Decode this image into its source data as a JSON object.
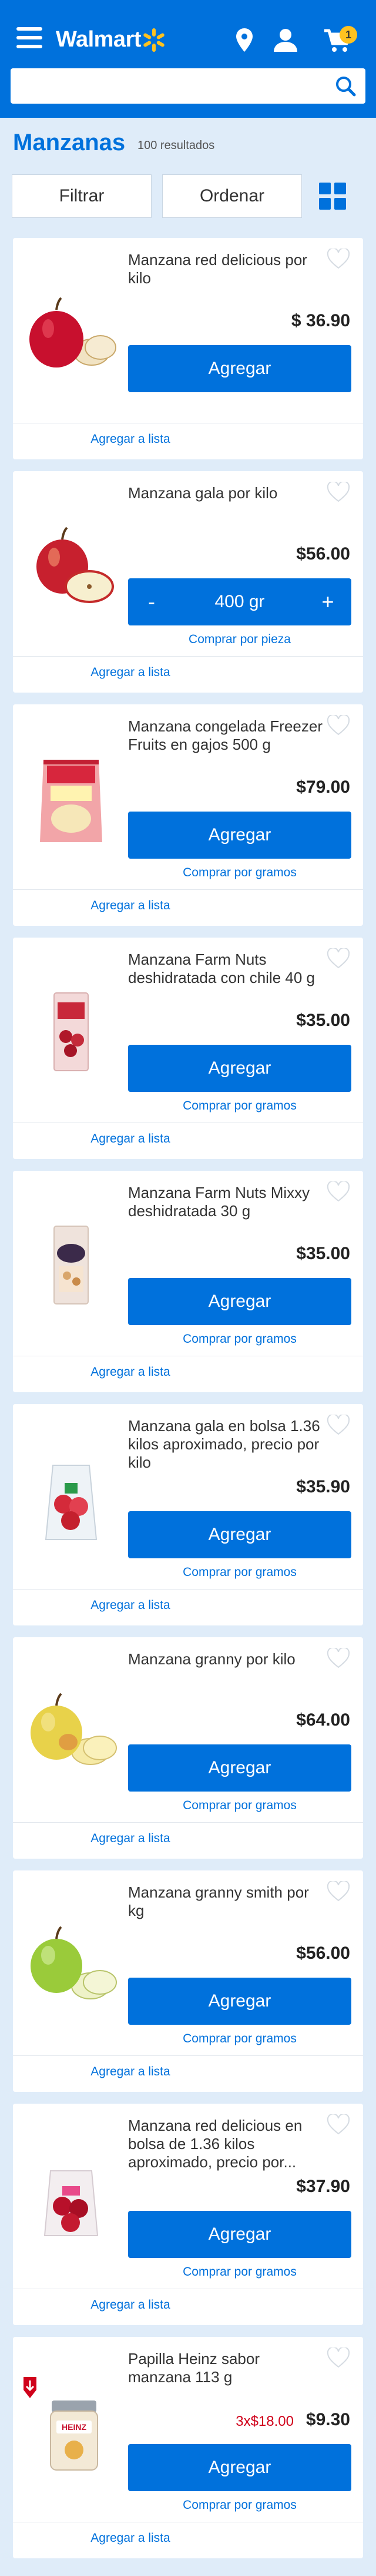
{
  "header": {
    "brand": "Walmart",
    "cart_count": "1",
    "search_placeholder": ""
  },
  "results": {
    "title": "Manzanas",
    "count": "100 resultados",
    "filter_label": "Filtrar",
    "sort_label": "Ordenar"
  },
  "colors": {
    "brand_blue": "#0071dc",
    "spark_yellow": "#ffc220",
    "promo_red": "#d0021b",
    "page_bg": "#dfecf9"
  },
  "products": [
    {
      "name": "Manzana red delicious por kilo",
      "price": "$ 36.90",
      "add_label": "Agregar",
      "list_label": "Agregar a lista",
      "image": "red-apple-slices"
    },
    {
      "name": "Manzana gala por kilo",
      "price": "$56.00",
      "qty_value": "400 gr",
      "qty_minus": "-",
      "qty_plus": "+",
      "buy_by": "Comprar por pieza",
      "list_label": "Agregar a lista",
      "image": "gala-apple-half"
    },
    {
      "name": "Manzana congelada Freezer Fruits en gajos 500 g",
      "price": "$79.00",
      "add_label": "Agregar",
      "buy_by": "Comprar por gramos",
      "list_label": "Agregar a lista",
      "image": "frozen-apple-bag"
    },
    {
      "name": "Manzana Farm Nuts deshidratada con chile 40 g",
      "price": "$35.00",
      "add_label": "Agregar",
      "buy_by": "Comprar por gramos",
      "list_label": "Agregar a lista",
      "image": "dried-apple-chile-bag"
    },
    {
      "name": "Manzana Farm Nuts Mixxy deshidratada 30 g",
      "price": "$35.00",
      "add_label": "Agregar",
      "buy_by": "Comprar por gramos",
      "list_label": "Agregar a lista",
      "image": "dried-apple-mixxy-bag"
    },
    {
      "name": "Manzana gala en bolsa 1.36 kilos aproximado, precio por kilo",
      "price": "$35.90",
      "add_label": "Agregar",
      "buy_by": "Comprar por gramos",
      "list_label": "Agregar a lista",
      "image": "gala-apple-bag"
    },
    {
      "name": "Manzana granny por kilo",
      "price": "$64.00",
      "add_label": "Agregar",
      "buy_by": "Comprar por gramos",
      "list_label": "Agregar a lista",
      "image": "yellow-apple-slices"
    },
    {
      "name": "Manzana granny smith por kg",
      "price": "$56.00",
      "add_label": "Agregar",
      "buy_by": "Comprar por gramos",
      "list_label": "Agregar a lista",
      "image": "green-apple-slices"
    },
    {
      "name": "Manzana red delicious en bolsa de 1.36 kilos aproximado, precio por...",
      "price": "$37.90",
      "add_label": "Agregar",
      "buy_by": "Comprar por gramos",
      "list_label": "Agregar a lista",
      "image": "red-apple-bag"
    },
    {
      "name": "Papilla Heinz sabor manzana 113 g",
      "price": "$9.30",
      "promo": "3x$18.00",
      "add_label": "Agregar",
      "buy_by": "Comprar por gramos",
      "list_label": "Agregar a lista",
      "image": "heinz-baby-food-jar"
    }
  ]
}
